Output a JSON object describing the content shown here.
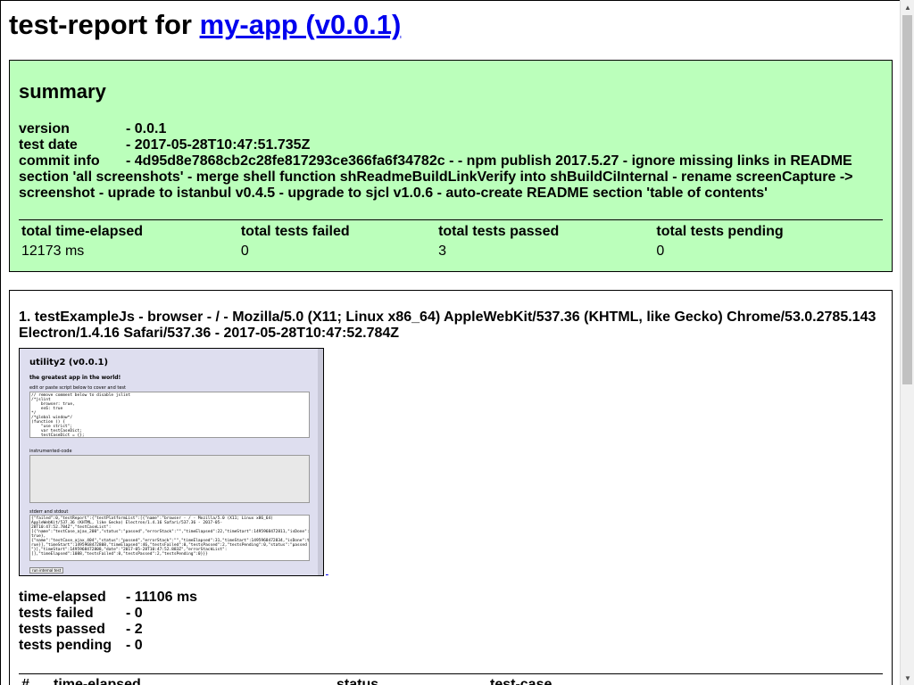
{
  "header": {
    "title_prefix": "test-report for ",
    "app_link": "my-app (v0.0.1)"
  },
  "summary": {
    "heading": "summary",
    "version_label": "version",
    "version_value": "- 0.0.1",
    "test_date_label": "test date",
    "test_date_value": "- 2017-05-28T10:47:51.735Z",
    "commit_label": "commit info",
    "commit_value": "- 4d95d8e7868cb2c28fe817293ce366fa6f34782c - - npm publish 2017.5.27 - ignore missing links in README section 'all screenshots' - merge shell function shReadmeBuildLinkVerify into shBuildCiInternal - rename screenCapture -> screenshot - uprade to istanbul v0.4.5 - upgrade to sjcl v1.0.6 - auto-create README section 'table of contents'",
    "stats_headers": [
      "total time-elapsed",
      "total tests failed",
      "total tests passed",
      "total tests pending"
    ],
    "stats_values": [
      "12173 ms",
      "0",
      "3",
      "0"
    ]
  },
  "test_platform": {
    "title": "1. testExampleJs - browser - / - Mozilla/5.0 (X11; Linux x86_64) AppleWebKit/537.36 (KHTML, like Gecko) Chrome/53.0.2785.143 Electron/1.4.16 Safari/537.36 - 2017-05-28T10:47:52.784Z",
    "screenshot": {
      "title": "utility2 (v0.0.1)",
      "subtitle": "the greatest app in the world!",
      "label1": "edit or paste script below to cover and test",
      "code": "// remove comment below to disable jslint\n/*jslint\n    browser: true,\n    es6: true\n*/\n/*global window*/\n(function () {\n    \"use strict\";\n    var testCaseDict;\n    testCaseDict = {};",
      "label2": "instrumented-code",
      "label3": "stderr and stdout",
      "output": "{\"failed\":0,\"testReport\":{\"testPlatformList\":[{\"name\":\"browser - / - Mozilla/5.0 (X11; Linux x86_64)\nAppleWebKit/537.36 (KHTML, like Gecko) Electron/1.4.16 Safari/537.36 - 2017-05-\n28T10:47:52.784Z\",\"testCaseList\":\n[{\"name\":\"testCase_ajax_200\",\"status\":\"passed\",\"errorStack\":\"\",\"timeElapsed\":22,\"timeStart\":1495968472811,\"isDone\":\ntrue},\n{\"name\":\"testCase_ajax_404\",\"status\":\"passed\",\"errorStack\":\"\",\"timeElapsed\":31,\"timeStart\":1495968472834,\"isDone\":t\nrue}],\"timeStart\":1495968472808,\"timeElapsed\":46,\"testsFailed\":0,\"testsPassed\":2,\"testsPending\":0,\"status\":\"passed\n\"}],\"timeStart\":1495968472808,\"date\":\"2017-05-28T10:47:52.883Z\",\"errorStackList\":\n[],\"timeElapsed\":1088,\"testsFailed\":0,\"testsPassed\":2,\"testsPending\":0}}}",
      "button": "run internal test"
    },
    "time_elapsed_label": "time-elapsed",
    "time_elapsed_value": "- 11106 ms",
    "failed_label": "tests failed",
    "failed_value": "- 0",
    "passed_label": "tests passed",
    "passed_value": "- 2",
    "pending_label": "tests pending",
    "pending_value": "- 0",
    "case_headers": [
      "#",
      "time-elapsed",
      "status",
      "test-case"
    ]
  }
}
